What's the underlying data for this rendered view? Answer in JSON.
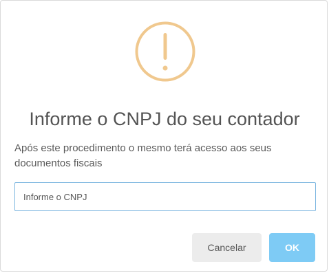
{
  "dialog": {
    "icon": "warning-icon",
    "title": "Informe o CNPJ do seu contador",
    "description": "Após este procedimento o mesmo terá acesso aos seus documentos fiscais",
    "input": {
      "placeholder": "Informe o CNPJ",
      "value": ""
    },
    "buttons": {
      "cancel_label": "Cancelar",
      "ok_label": "OK"
    }
  },
  "colors": {
    "warning": "#f0c88e",
    "input_border": "#7cb6e0",
    "cancel_bg": "#ececec",
    "ok_bg": "#7ecbf5"
  }
}
